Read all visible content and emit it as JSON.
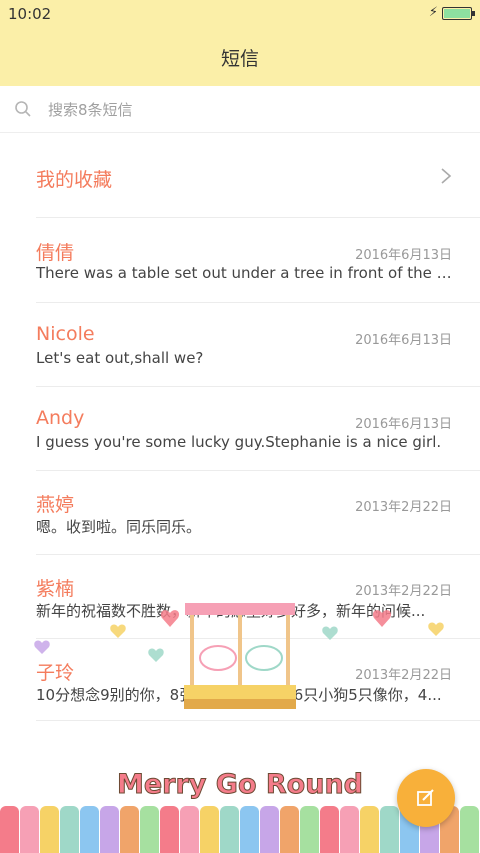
{
  "status_bar": {
    "time": "10:02",
    "battery_level": 0.92
  },
  "header": {
    "title": "短信"
  },
  "search": {
    "placeholder": "搜索8条短信"
  },
  "favorites": {
    "label": "我的收藏"
  },
  "conversations": [
    {
      "name": "倩倩",
      "date": "2016年6月13日",
      "preview": "There was a table set out under a tree in front of the ho..."
    },
    {
      "name": "Nicole",
      "date": "2016年6月13日",
      "preview": "Let's eat out,shall we?"
    },
    {
      "name": "Andy",
      "date": "2016年6月13日",
      "preview": "I guess you're some lucky guy.Stephanie is a nice girl."
    },
    {
      "name": "燕婷",
      "date": "2013年2月22日",
      "preview": "嗯。收到啦。同乐同乐。"
    },
    {
      "name": "紫楠",
      "date": "2013年2月22日",
      "preview": "新年的祝福数不胜数，新年的愿望好多好多，新年的问候..."
    },
    {
      "name": "子玲",
      "date": "2013年2月22日",
      "preview": "10分想念9别的你，8张照片7张是你，6只小狗5只像你，4..."
    }
  ],
  "decoration": {
    "banner_text": "Merry Go Round"
  },
  "fab": {
    "icon": "compose-icon"
  },
  "colors": {
    "accent": "#f47c5d",
    "header_bg": "#fbefa8",
    "fab": "#f8b03a"
  }
}
